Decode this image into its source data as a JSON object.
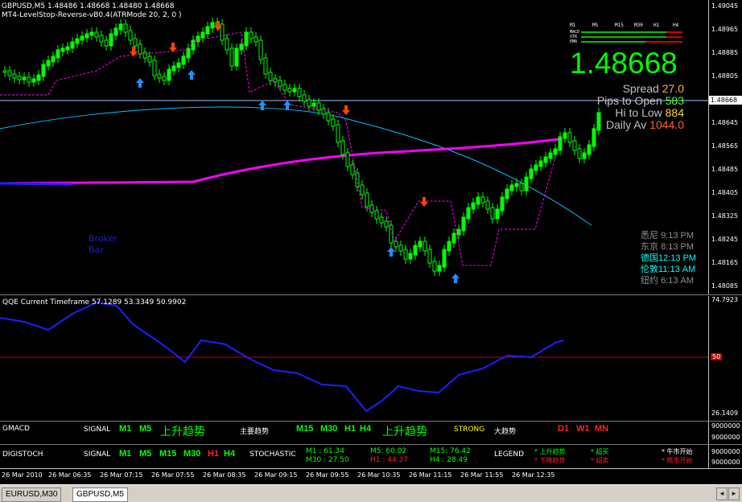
{
  "chart_header": {
    "symbol_line": "GBPUSD,M5  1.48486  1.48668  1.48480  1.48668",
    "indicator_line": "MT4-LevelStop-Reverse-vB0.4(ATRMode 20, 2, 0 )"
  },
  "price_axis": {
    "labels": [
      "1.49045",
      "1.48965",
      "1.48885",
      "1.48805",
      "1.48725",
      "1.48645",
      "1.48565",
      "1.48485",
      "1.48405",
      "1.48325",
      "1.48245",
      "1.48165",
      "1.48085"
    ],
    "current_price_tag": "1.48668"
  },
  "info_panel": {
    "mini_labels": [
      "M1",
      "M5",
      "M15",
      "M30",
      "H1",
      "H4"
    ],
    "row_labels": [
      "MACD",
      "STR",
      "EMA"
    ],
    "big_price": "1.48668",
    "spread_label": "Spread",
    "spread_value": "27.0",
    "pips_label": "Pips to Open",
    "pips_value": "583",
    "hilow_label": "Hi to Low",
    "hilow_value": "884",
    "daily_label": "Daily Av",
    "daily_value": "1044.0"
  },
  "clocks": [
    {
      "city": "悉尼",
      "time": "9:13 PM"
    },
    {
      "city": "东京",
      "time": "8:13 PM"
    },
    {
      "city": "德国",
      "time": "12:13 PM"
    },
    {
      "city": "伦敦",
      "time": "11:13 AM"
    },
    {
      "city": "纽约",
      "time": "6:13 AM"
    }
  ],
  "broker_text": [
    "Broker",
    "Bar"
  ],
  "qqe": {
    "title": "QQE Current Timeframe 57.1289 53.3349 50.9902",
    "axis_top": "74.7923",
    "axis_bottom": "26.1409",
    "axis_mid": "50"
  },
  "gmacd": {
    "name": "GMACD",
    "signal": "SIGNAL",
    "tf_a": [
      "M1",
      "M5"
    ],
    "trend_up": "上升趋势",
    "main_trend": "主要趋势",
    "tf_b": [
      "M15",
      "M30",
      "H1",
      "H4"
    ],
    "trend_up2": "上升趋势",
    "strong": "STRONG",
    "big_trend": "大趋势",
    "tf_c": [
      "D1",
      "W1",
      "MN"
    ],
    "axis_a": "9000000",
    "axis_b": "9000000"
  },
  "digistoch": {
    "name": "DIGISTOCH",
    "signal": "SIGNAL",
    "tf_green": [
      "M1",
      "M5",
      "M15",
      "M30"
    ],
    "tf_red": "H1",
    "tf_green2": "H4",
    "stochastic": "STOCHASTIC",
    "m1": "M1 : 61.34",
    "m30": "M30 : 27.50",
    "m5": "M5: 60.02",
    "h1": "H1 : 44.37",
    "m15": "M15: 76.42",
    "h4": "H4 : 28.49",
    "legend": "LEGEND",
    "leg_up": "* 上升趋势",
    "leg_down": "* 下降趋势",
    "leg_ob": "* 超买",
    "leg_os": "* 超卖",
    "leg_bull": "* 牛市开始",
    "leg_bear": "* 熊市开始",
    "axis_a": "9000000",
    "axis_b": "9000000"
  },
  "time_axis": [
    "26 Mar 2010",
    "26 Mar 06:35",
    "26 Mar 07:15",
    "26 Mar 07:55",
    "26 Mar 08:35",
    "26 Mar 09:15",
    "26 Mar 09:55",
    "26 Mar 10:35",
    "26 Mar 11:15",
    "26 Mar 11:55",
    "26 Mar 12:35"
  ],
  "tabs": [
    "EURUSD,M30",
    "GBPUSD,M5"
  ],
  "colors": {
    "bull": "#00ff00",
    "bear": "#00ff00",
    "levelstop": "#ff00ff",
    "ma_slow": "#00bfff",
    "ma_fast": "#ff00ff",
    "qqe": "#1e1eff",
    "up_arrow": "#1e90ff",
    "down_arrow": "#ff4500"
  }
}
